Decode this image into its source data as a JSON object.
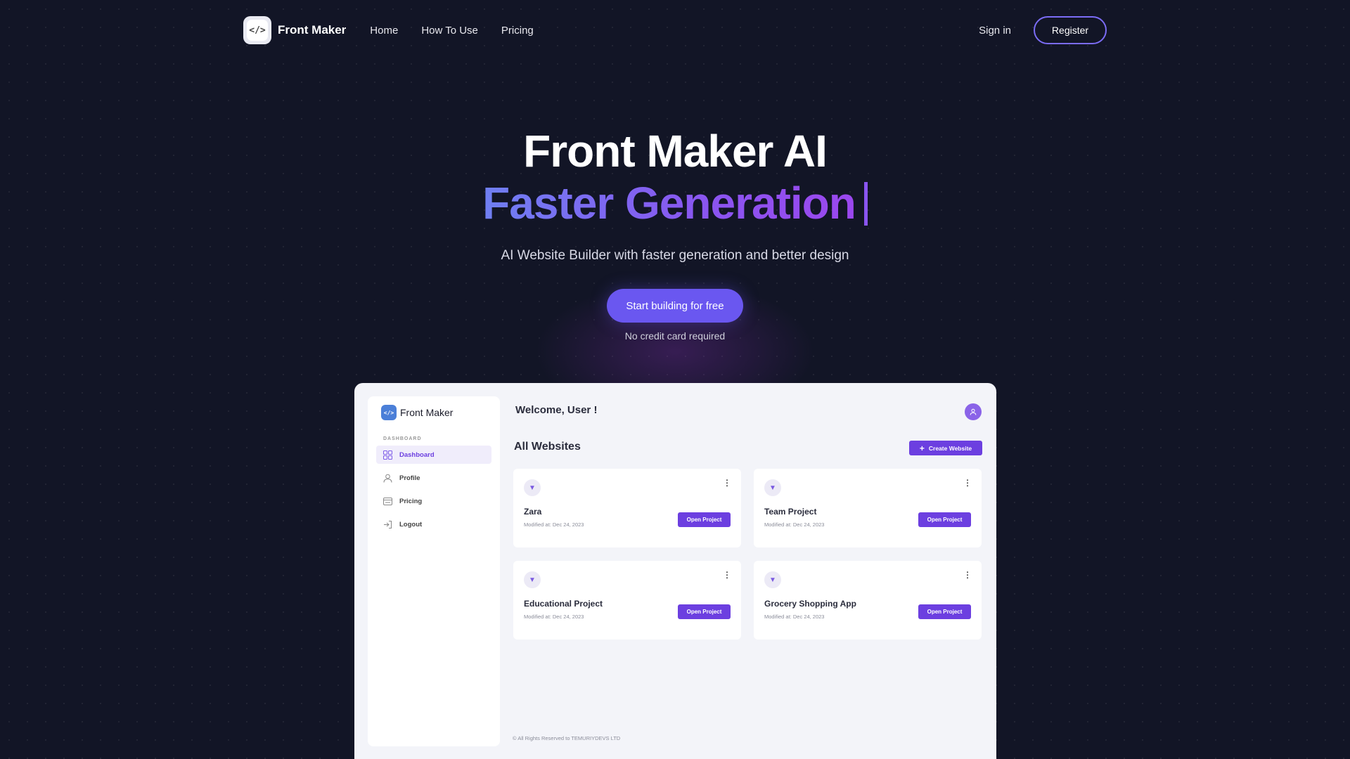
{
  "nav": {
    "logo_glyph": "</>",
    "brand": "Front Maker",
    "links": [
      "Home",
      "How To Use",
      "Pricing"
    ],
    "signin": "Sign in",
    "register": "Register"
  },
  "hero": {
    "title": "Front Maker AI",
    "subtitle": "Faster Generation",
    "tagline": "AI Website Builder with faster generation and better design",
    "cta": "Start building for free",
    "note": "No credit card required",
    "gradient_colors": [
      "#6f7ff2",
      "#8a55f0",
      "#9b47ee"
    ]
  },
  "dashboard": {
    "brand": "Front Maker",
    "logo_glyph": "</>",
    "section_label": "DASHBOARD",
    "nav_items": [
      {
        "label": "Dashboard",
        "icon": "grid-icon",
        "active": true
      },
      {
        "label": "Profile",
        "icon": "user-icon",
        "active": false
      },
      {
        "label": "Pricing",
        "icon": "card-icon",
        "active": false
      },
      {
        "label": "Logout",
        "icon": "logout-icon",
        "active": false
      }
    ],
    "welcome": "Welcome, User !",
    "all_websites": "All Websites",
    "create_label": "Create Website",
    "projects": [
      {
        "name": "Zara",
        "modified": "Modified at: Dec 24, 2023",
        "button": "Open Project"
      },
      {
        "name": "Team Project",
        "modified": "Modified at: Dec 24, 2023",
        "button": "Open Project"
      },
      {
        "name": "Educational Project",
        "modified": "Modified at: Dec 24, 2023",
        "button": "Open Project"
      },
      {
        "name": "Grocery Shopping App",
        "modified": "Modified at: Dec 24, 2023",
        "button": "Open Project"
      }
    ],
    "footer": "© All Rights Reserved to TEMURIYDEVS LTD",
    "accent_color": "#6c3fe0"
  }
}
